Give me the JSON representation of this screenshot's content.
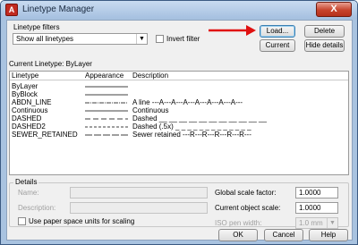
{
  "window": {
    "title": "Linetype Manager",
    "close_label": "X",
    "app_icon": "A"
  },
  "filters": {
    "group_label": "Linetype filters",
    "filter_value": "Show all linetypes",
    "invert_label": "Invert filter"
  },
  "buttons": {
    "load": "Load...",
    "delete": "Delete",
    "current": "Current",
    "hide_details": "Hide details",
    "ok": "OK",
    "cancel": "Cancel",
    "help": "Help"
  },
  "current_linetype": {
    "label": "Current Linetype:",
    "value": "ByLayer"
  },
  "list": {
    "headers": {
      "linetype": "Linetype",
      "appearance": "Appearance",
      "description": "Description"
    },
    "rows": [
      {
        "name": "ByLayer",
        "pattern": "solid",
        "description": ""
      },
      {
        "name": "ByBlock",
        "pattern": "solid",
        "description": ""
      },
      {
        "name": "ABDN_LINE",
        "pattern": "abdn",
        "description": "A line ---A---A---A---A---A---A---A---"
      },
      {
        "name": "Continuous",
        "pattern": "solid",
        "description": "Continuous"
      },
      {
        "name": "DASHED",
        "pattern": "dashed",
        "description": "Dashed __ __ __ __ __ __ __ __ __ __ __"
      },
      {
        "name": "DASHED2",
        "pattern": "dashed_small",
        "description": "Dashed (.5x) _ _ _ _ _ _ _ _ _ _ _ _ _"
      },
      {
        "name": "SEWER_RETAINED",
        "pattern": "sewer",
        "description": "Sewer retained ---R---R---R---R---R---"
      }
    ]
  },
  "details": {
    "group_label": "Details",
    "name_label": "Name:",
    "description_label": "Description:",
    "paper_space_label": "Use paper space units for scaling",
    "global_scale_label": "Global scale factor:",
    "global_scale_value": "1.0000",
    "object_scale_label": "Current object scale:",
    "object_scale_value": "1.0000",
    "pen_width_label": "ISO pen width:",
    "pen_width_value": "1.0 mm"
  },
  "colors": {
    "annotation_arrow": "#e01010",
    "title_bar": "#b8cfe8"
  }
}
